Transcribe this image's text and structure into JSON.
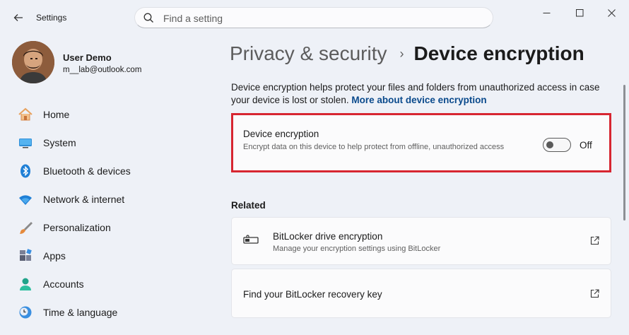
{
  "window": {
    "app_title": "Settings",
    "search_placeholder": "Find a setting"
  },
  "user": {
    "name": "User Demo",
    "email": "m__lab@outlook.com"
  },
  "sidebar": {
    "items": [
      {
        "label": "Home",
        "icon": "home-icon"
      },
      {
        "label": "System",
        "icon": "system-icon"
      },
      {
        "label": "Bluetooth & devices",
        "icon": "bluetooth-icon"
      },
      {
        "label": "Network & internet",
        "icon": "wifi-icon"
      },
      {
        "label": "Personalization",
        "icon": "brush-icon"
      },
      {
        "label": "Apps",
        "icon": "apps-icon"
      },
      {
        "label": "Accounts",
        "icon": "accounts-icon"
      },
      {
        "label": "Time & language",
        "icon": "time-language-icon"
      }
    ]
  },
  "breadcrumb": {
    "parent": "Privacy & security",
    "separator": "›",
    "current": "Device encryption"
  },
  "main": {
    "description": "Device encryption helps protect your files and folders from unauthorized access in case your device is lost or stolen.",
    "more_link": "More about device encryption",
    "encryption_card": {
      "title": "Device encryption",
      "subtitle": "Encrypt data on this device to help protect from offline, unauthorized access",
      "toggle_state": "Off",
      "toggle_on": false
    },
    "related": {
      "heading": "Related",
      "items": [
        {
          "title": "BitLocker drive encryption",
          "subtitle": "Manage your encryption settings using BitLocker",
          "icon": "bitlocker-key-icon"
        },
        {
          "title": "Find your BitLocker recovery key",
          "subtitle": ""
        }
      ]
    }
  },
  "colors": {
    "highlight_border": "#d72631",
    "link": "#0a4a8c",
    "background": "#eef1f7"
  }
}
